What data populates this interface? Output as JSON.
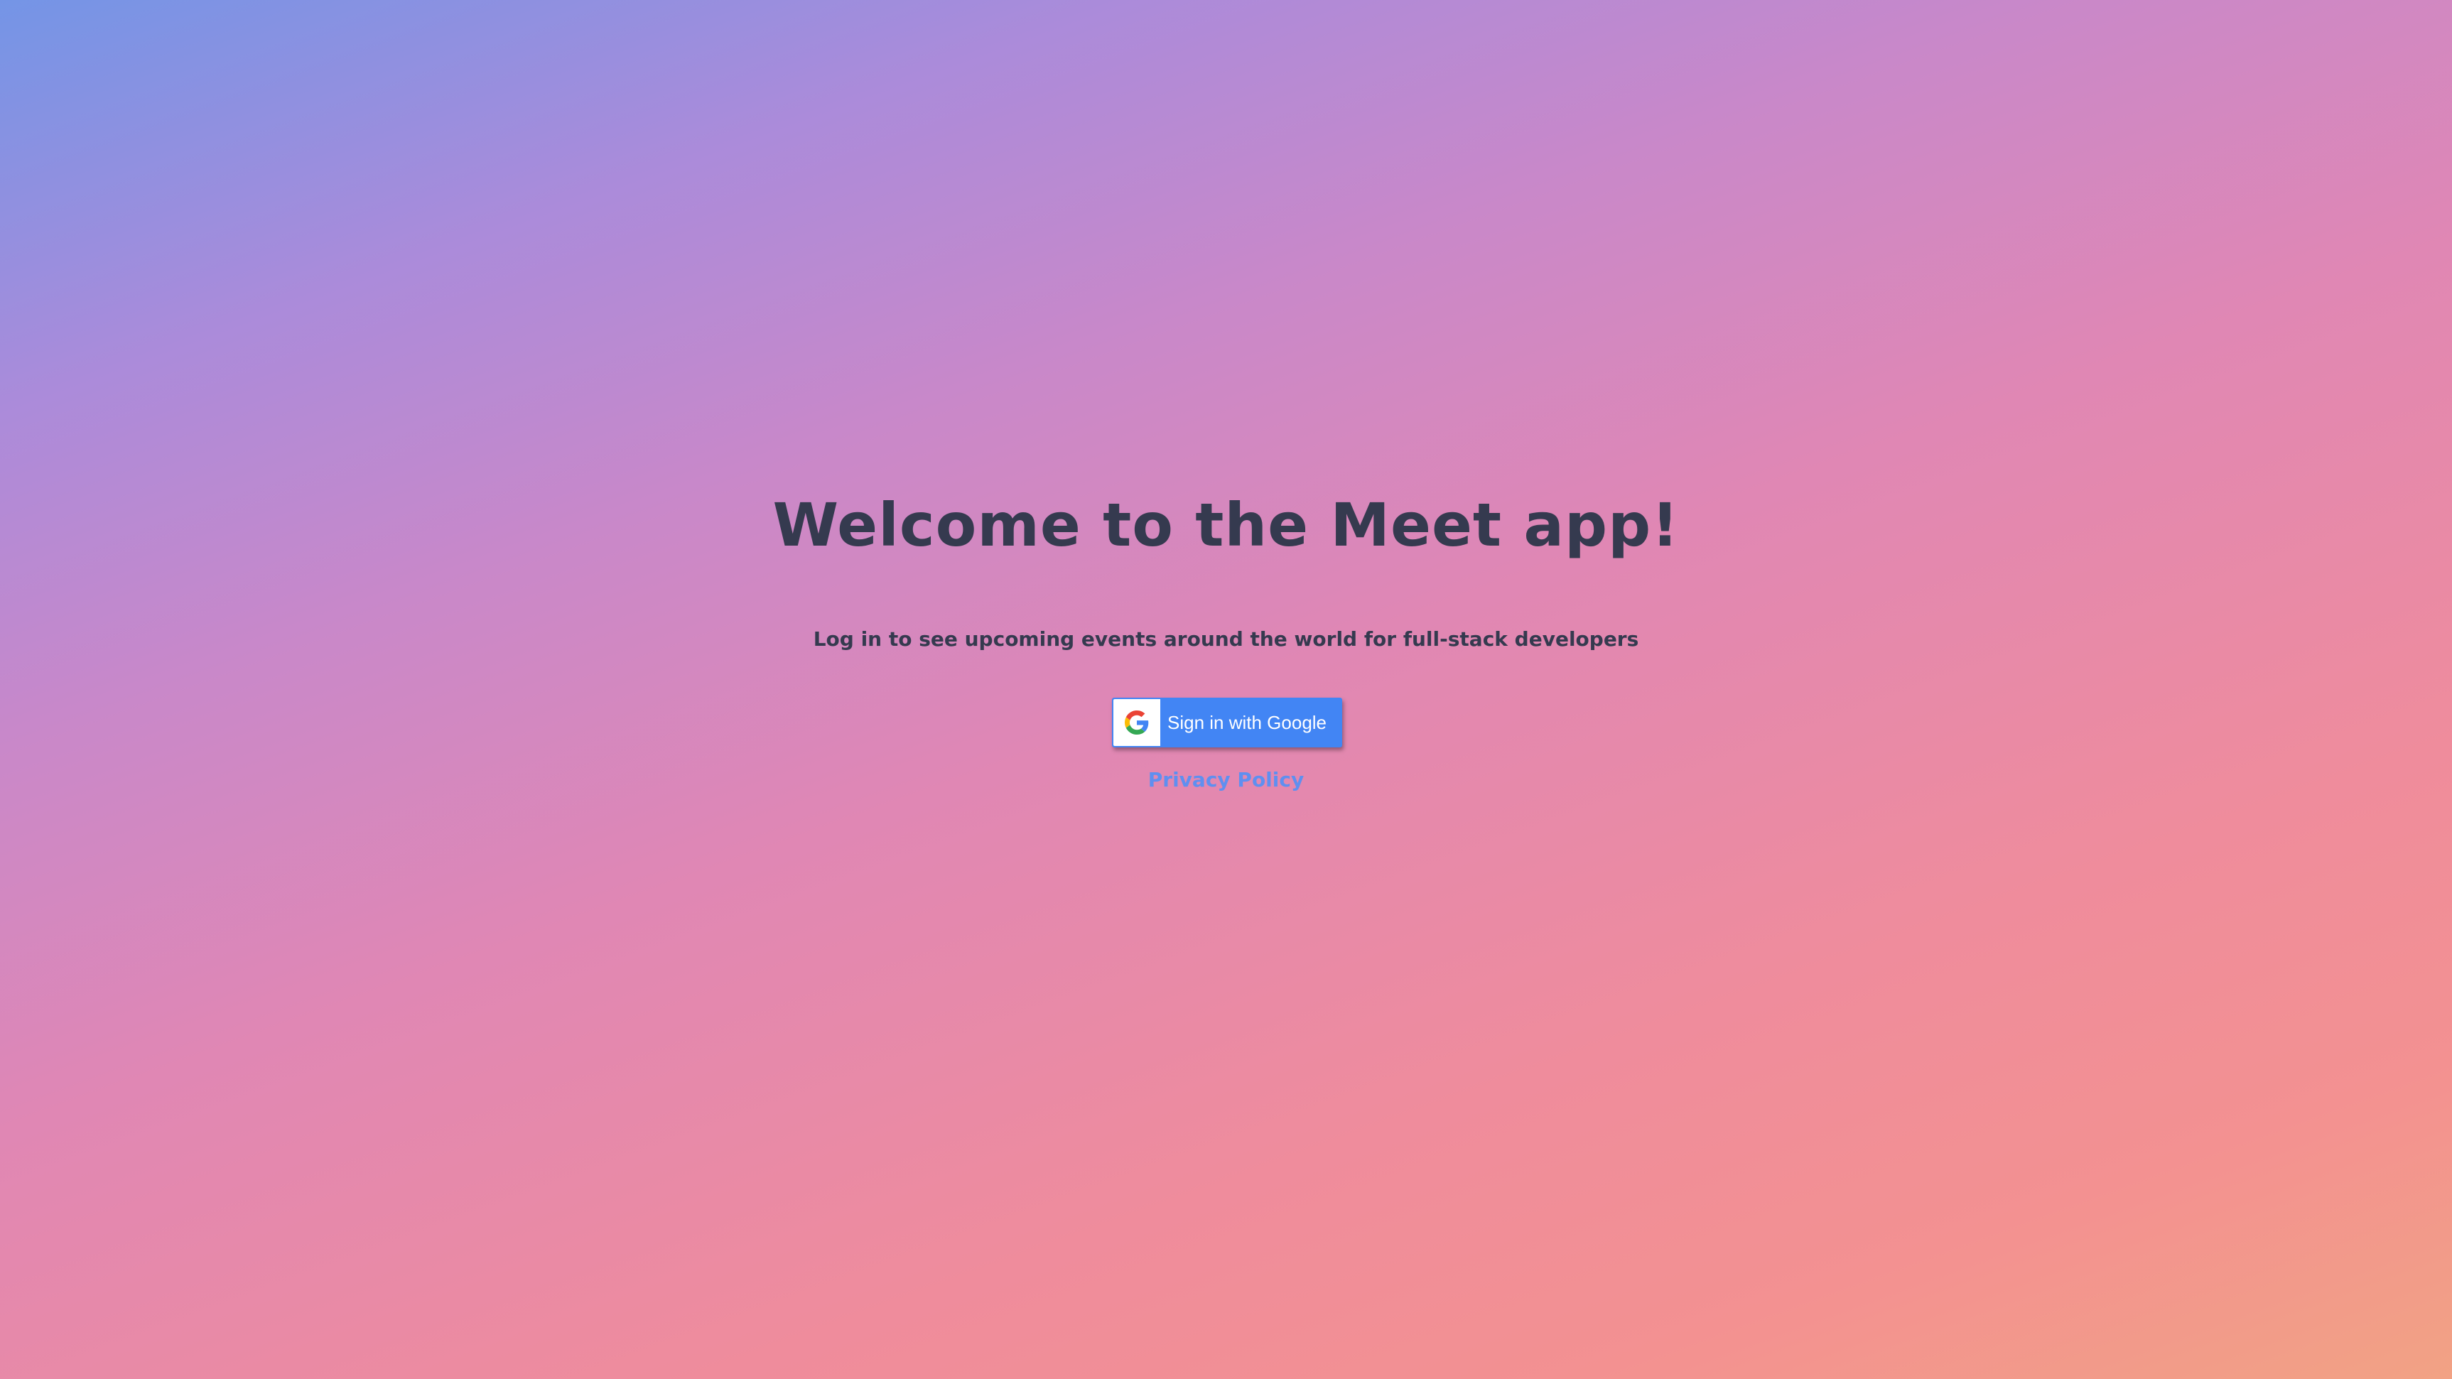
{
  "page": {
    "title": "Welcome to the Meet app!",
    "subtitle": "Log in to see upcoming events around the world for full-stack developers"
  },
  "google_sign_in": {
    "label": "Sign in with Google",
    "icon": "google-g-icon",
    "button_color": "#4285f4"
  },
  "privacy_link": {
    "label": "Privacy Policy",
    "color": "#5f8ff0"
  },
  "colors": {
    "text": "#353a4f",
    "background_gradient": [
      "#7495e6",
      "#ab8bda",
      "#e087b4",
      "#f39191",
      "#f2a284"
    ]
  }
}
